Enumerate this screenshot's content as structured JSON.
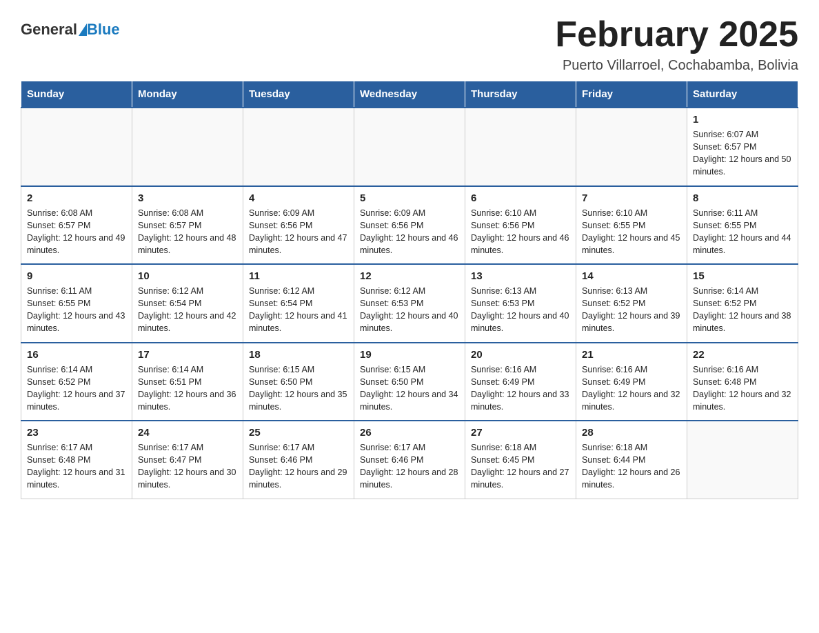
{
  "header": {
    "logo_general": "General",
    "logo_blue": "Blue",
    "title": "February 2025",
    "subtitle": "Puerto Villarroel, Cochabamba, Bolivia"
  },
  "days_of_week": [
    "Sunday",
    "Monday",
    "Tuesday",
    "Wednesday",
    "Thursday",
    "Friday",
    "Saturday"
  ],
  "weeks": [
    [
      {
        "day": "",
        "sunrise": "",
        "sunset": "",
        "daylight": ""
      },
      {
        "day": "",
        "sunrise": "",
        "sunset": "",
        "daylight": ""
      },
      {
        "day": "",
        "sunrise": "",
        "sunset": "",
        "daylight": ""
      },
      {
        "day": "",
        "sunrise": "",
        "sunset": "",
        "daylight": ""
      },
      {
        "day": "",
        "sunrise": "",
        "sunset": "",
        "daylight": ""
      },
      {
        "day": "",
        "sunrise": "",
        "sunset": "",
        "daylight": ""
      },
      {
        "day": "1",
        "sunrise": "Sunrise: 6:07 AM",
        "sunset": "Sunset: 6:57 PM",
        "daylight": "Daylight: 12 hours and 50 minutes."
      }
    ],
    [
      {
        "day": "2",
        "sunrise": "Sunrise: 6:08 AM",
        "sunset": "Sunset: 6:57 PM",
        "daylight": "Daylight: 12 hours and 49 minutes."
      },
      {
        "day": "3",
        "sunrise": "Sunrise: 6:08 AM",
        "sunset": "Sunset: 6:57 PM",
        "daylight": "Daylight: 12 hours and 48 minutes."
      },
      {
        "day": "4",
        "sunrise": "Sunrise: 6:09 AM",
        "sunset": "Sunset: 6:56 PM",
        "daylight": "Daylight: 12 hours and 47 minutes."
      },
      {
        "day": "5",
        "sunrise": "Sunrise: 6:09 AM",
        "sunset": "Sunset: 6:56 PM",
        "daylight": "Daylight: 12 hours and 46 minutes."
      },
      {
        "day": "6",
        "sunrise": "Sunrise: 6:10 AM",
        "sunset": "Sunset: 6:56 PM",
        "daylight": "Daylight: 12 hours and 46 minutes."
      },
      {
        "day": "7",
        "sunrise": "Sunrise: 6:10 AM",
        "sunset": "Sunset: 6:55 PM",
        "daylight": "Daylight: 12 hours and 45 minutes."
      },
      {
        "day": "8",
        "sunrise": "Sunrise: 6:11 AM",
        "sunset": "Sunset: 6:55 PM",
        "daylight": "Daylight: 12 hours and 44 minutes."
      }
    ],
    [
      {
        "day": "9",
        "sunrise": "Sunrise: 6:11 AM",
        "sunset": "Sunset: 6:55 PM",
        "daylight": "Daylight: 12 hours and 43 minutes."
      },
      {
        "day": "10",
        "sunrise": "Sunrise: 6:12 AM",
        "sunset": "Sunset: 6:54 PM",
        "daylight": "Daylight: 12 hours and 42 minutes."
      },
      {
        "day": "11",
        "sunrise": "Sunrise: 6:12 AM",
        "sunset": "Sunset: 6:54 PM",
        "daylight": "Daylight: 12 hours and 41 minutes."
      },
      {
        "day": "12",
        "sunrise": "Sunrise: 6:12 AM",
        "sunset": "Sunset: 6:53 PM",
        "daylight": "Daylight: 12 hours and 40 minutes."
      },
      {
        "day": "13",
        "sunrise": "Sunrise: 6:13 AM",
        "sunset": "Sunset: 6:53 PM",
        "daylight": "Daylight: 12 hours and 40 minutes."
      },
      {
        "day": "14",
        "sunrise": "Sunrise: 6:13 AM",
        "sunset": "Sunset: 6:52 PM",
        "daylight": "Daylight: 12 hours and 39 minutes."
      },
      {
        "day": "15",
        "sunrise": "Sunrise: 6:14 AM",
        "sunset": "Sunset: 6:52 PM",
        "daylight": "Daylight: 12 hours and 38 minutes."
      }
    ],
    [
      {
        "day": "16",
        "sunrise": "Sunrise: 6:14 AM",
        "sunset": "Sunset: 6:52 PM",
        "daylight": "Daylight: 12 hours and 37 minutes."
      },
      {
        "day": "17",
        "sunrise": "Sunrise: 6:14 AM",
        "sunset": "Sunset: 6:51 PM",
        "daylight": "Daylight: 12 hours and 36 minutes."
      },
      {
        "day": "18",
        "sunrise": "Sunrise: 6:15 AM",
        "sunset": "Sunset: 6:50 PM",
        "daylight": "Daylight: 12 hours and 35 minutes."
      },
      {
        "day": "19",
        "sunrise": "Sunrise: 6:15 AM",
        "sunset": "Sunset: 6:50 PM",
        "daylight": "Daylight: 12 hours and 34 minutes."
      },
      {
        "day": "20",
        "sunrise": "Sunrise: 6:16 AM",
        "sunset": "Sunset: 6:49 PM",
        "daylight": "Daylight: 12 hours and 33 minutes."
      },
      {
        "day": "21",
        "sunrise": "Sunrise: 6:16 AM",
        "sunset": "Sunset: 6:49 PM",
        "daylight": "Daylight: 12 hours and 32 minutes."
      },
      {
        "day": "22",
        "sunrise": "Sunrise: 6:16 AM",
        "sunset": "Sunset: 6:48 PM",
        "daylight": "Daylight: 12 hours and 32 minutes."
      }
    ],
    [
      {
        "day": "23",
        "sunrise": "Sunrise: 6:17 AM",
        "sunset": "Sunset: 6:48 PM",
        "daylight": "Daylight: 12 hours and 31 minutes."
      },
      {
        "day": "24",
        "sunrise": "Sunrise: 6:17 AM",
        "sunset": "Sunset: 6:47 PM",
        "daylight": "Daylight: 12 hours and 30 minutes."
      },
      {
        "day": "25",
        "sunrise": "Sunrise: 6:17 AM",
        "sunset": "Sunset: 6:46 PM",
        "daylight": "Daylight: 12 hours and 29 minutes."
      },
      {
        "day": "26",
        "sunrise": "Sunrise: 6:17 AM",
        "sunset": "Sunset: 6:46 PM",
        "daylight": "Daylight: 12 hours and 28 minutes."
      },
      {
        "day": "27",
        "sunrise": "Sunrise: 6:18 AM",
        "sunset": "Sunset: 6:45 PM",
        "daylight": "Daylight: 12 hours and 27 minutes."
      },
      {
        "day": "28",
        "sunrise": "Sunrise: 6:18 AM",
        "sunset": "Sunset: 6:44 PM",
        "daylight": "Daylight: 12 hours and 26 minutes."
      },
      {
        "day": "",
        "sunrise": "",
        "sunset": "",
        "daylight": ""
      }
    ]
  ]
}
